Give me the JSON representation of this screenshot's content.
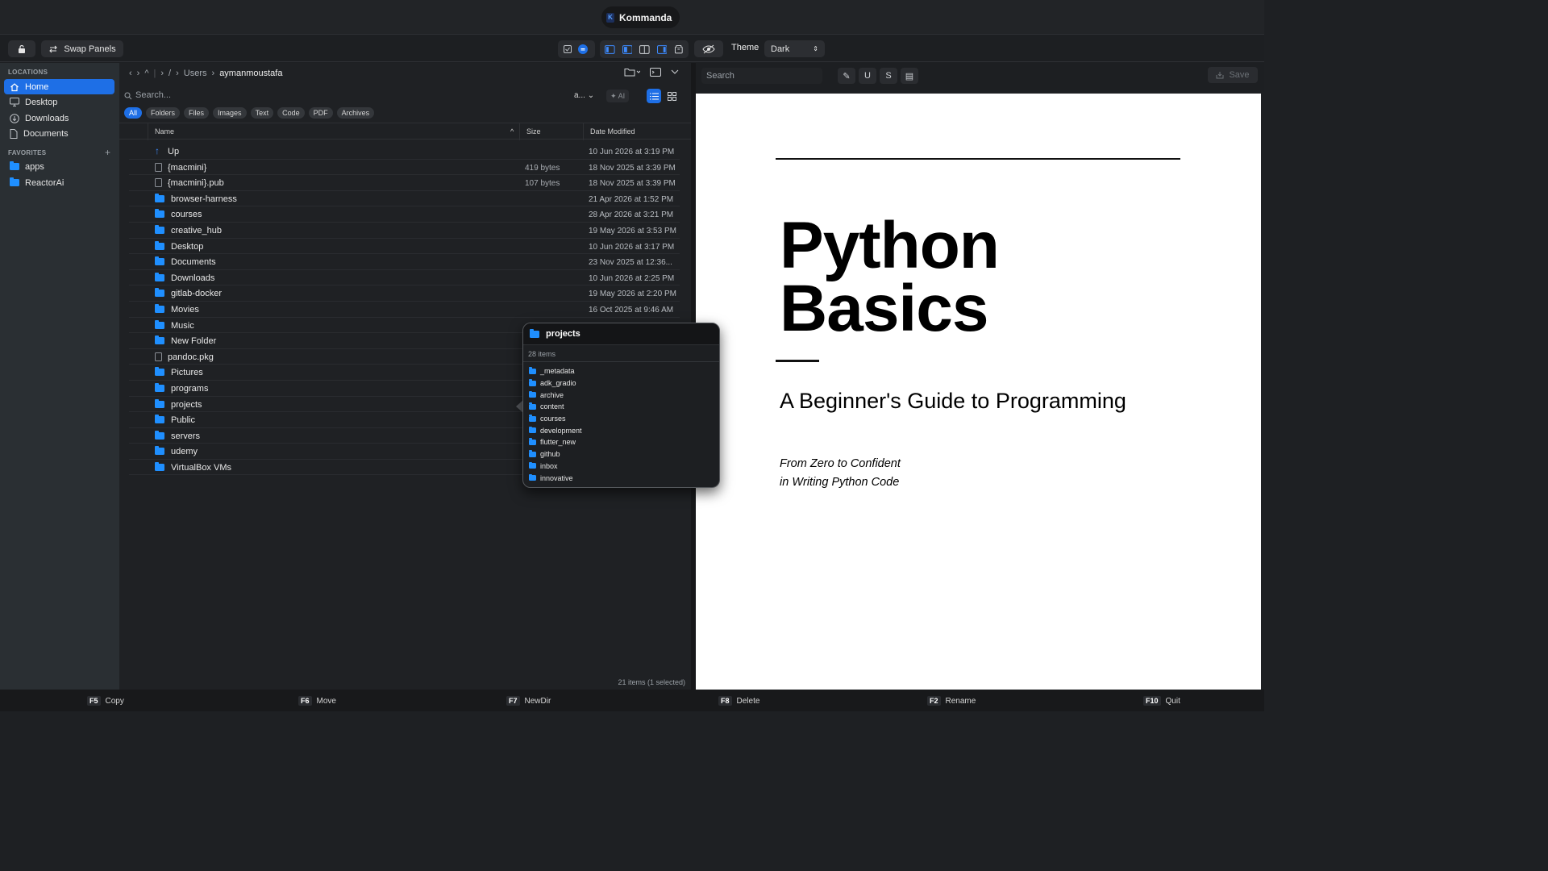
{
  "app": {
    "title": "Kommanda",
    "logo": "K"
  },
  "toolbar": {
    "swap_label": "Swap Panels",
    "theme_label": "Theme",
    "theme_value": "Dark"
  },
  "sidebar": {
    "locations_heading": "LOCATIONS",
    "favorites_heading": "FAVORITES",
    "locations": [
      {
        "label": "Home",
        "icon": "home-icon",
        "active": true
      },
      {
        "label": "Desktop",
        "icon": "desktop-icon"
      },
      {
        "label": "Downloads",
        "icon": "download-icon"
      },
      {
        "label": "Documents",
        "icon": "document-icon"
      }
    ],
    "favorites": [
      {
        "label": "apps",
        "icon": "folder-icon"
      },
      {
        "label": "ReactorAi",
        "icon": "folder-icon"
      }
    ]
  },
  "left": {
    "breadcrumb": {
      "root": "/",
      "parent": "Users",
      "current": "aymanmoustafa"
    },
    "search_placeholder": "Search...",
    "sort_label": "a...",
    "ai_label": "AI",
    "chips": [
      "All",
      "Folders",
      "Files",
      "Images",
      "Text",
      "Code",
      "PDF",
      "Archives"
    ],
    "columns": {
      "name": "Name",
      "size": "Size",
      "date": "Date Modified"
    },
    "rows": [
      {
        "name": "Up",
        "type": "up",
        "size": "",
        "date": "10 Jun 2026 at 3:19 PM"
      },
      {
        "name": "{macmini}",
        "type": "file",
        "size": "419 bytes",
        "date": "18 Nov 2025 at 3:39 PM"
      },
      {
        "name": "{macmini}.pub",
        "type": "file",
        "size": "107 bytes",
        "date": "18 Nov 2025 at 3:39 PM"
      },
      {
        "name": "browser-harness",
        "type": "folder",
        "size": "",
        "date": "21 Apr 2026 at 1:52 PM"
      },
      {
        "name": "courses",
        "type": "folder",
        "size": "",
        "date": "28 Apr 2026 at 3:21 PM"
      },
      {
        "name": "creative_hub",
        "type": "folder",
        "size": "",
        "date": "19 May 2026 at 3:53 PM"
      },
      {
        "name": "Desktop",
        "type": "folder",
        "size": "",
        "date": "10 Jun 2026 at 3:17 PM"
      },
      {
        "name": "Documents",
        "type": "folder",
        "size": "",
        "date": "23 Nov 2025 at 12:36..."
      },
      {
        "name": "Downloads",
        "type": "folder",
        "size": "",
        "date": "10 Jun 2026 at 2:25 PM"
      },
      {
        "name": "gitlab-docker",
        "type": "folder",
        "size": "",
        "date": "19 May 2026 at 2:20 PM"
      },
      {
        "name": "Movies",
        "type": "folder",
        "size": "",
        "date": "16 Oct 2025 at 9:46 AM"
      },
      {
        "name": "Music",
        "type": "folder",
        "size": "",
        "date": ""
      },
      {
        "name": "New Folder",
        "type": "folder",
        "size": "",
        "date": ""
      },
      {
        "name": "pandoc.pkg",
        "type": "file",
        "size": "",
        "date": ""
      },
      {
        "name": "Pictures",
        "type": "folder",
        "size": "",
        "date": ""
      },
      {
        "name": "programs",
        "type": "folder",
        "size": "",
        "date": ""
      },
      {
        "name": "projects",
        "type": "folder",
        "size": "",
        "date": ""
      },
      {
        "name": "Public",
        "type": "folder",
        "size": "",
        "date": ""
      },
      {
        "name": "servers",
        "type": "folder",
        "size": "",
        "date": ""
      },
      {
        "name": "udemy",
        "type": "folder",
        "size": "",
        "date": ""
      },
      {
        "name": "VirtualBox VMs",
        "type": "folder",
        "size": "",
        "date": ""
      }
    ],
    "status": "21 items (1 selected)"
  },
  "popup": {
    "title": "projects",
    "count": "28 items",
    "items": [
      "_metadata",
      "adk_gradio",
      "archive",
      "content",
      "courses",
      "development",
      "flutter_new",
      "github",
      "inbox",
      "innovative"
    ]
  },
  "right": {
    "search_placeholder": "Search",
    "format_buttons": [
      {
        "name": "pen-icon",
        "label": "✎"
      },
      {
        "name": "underline-button",
        "label": "U"
      },
      {
        "name": "strikethrough-button",
        "label": "S"
      },
      {
        "name": "note-icon",
        "label": "▤"
      }
    ],
    "save_label": "Save",
    "doc": {
      "title_line1": "Python",
      "title_line2": "Basics",
      "subtitle": "A Beginner's Guide to Programming",
      "tagline1": "From Zero to Confident",
      "tagline2": "in Writing Python Code"
    }
  },
  "fkeys": [
    {
      "key": "F5",
      "label": "Copy"
    },
    {
      "key": "F6",
      "label": "Move"
    },
    {
      "key": "F7",
      "label": "NewDir"
    },
    {
      "key": "F8",
      "label": "Delete"
    },
    {
      "key": "F2",
      "label": "Rename"
    },
    {
      "key": "F10",
      "label": "Quit"
    }
  ],
  "colors": {
    "accent": "#1e6fe6",
    "folder": "#1f8fff",
    "sidebar": "#2a2f33"
  }
}
